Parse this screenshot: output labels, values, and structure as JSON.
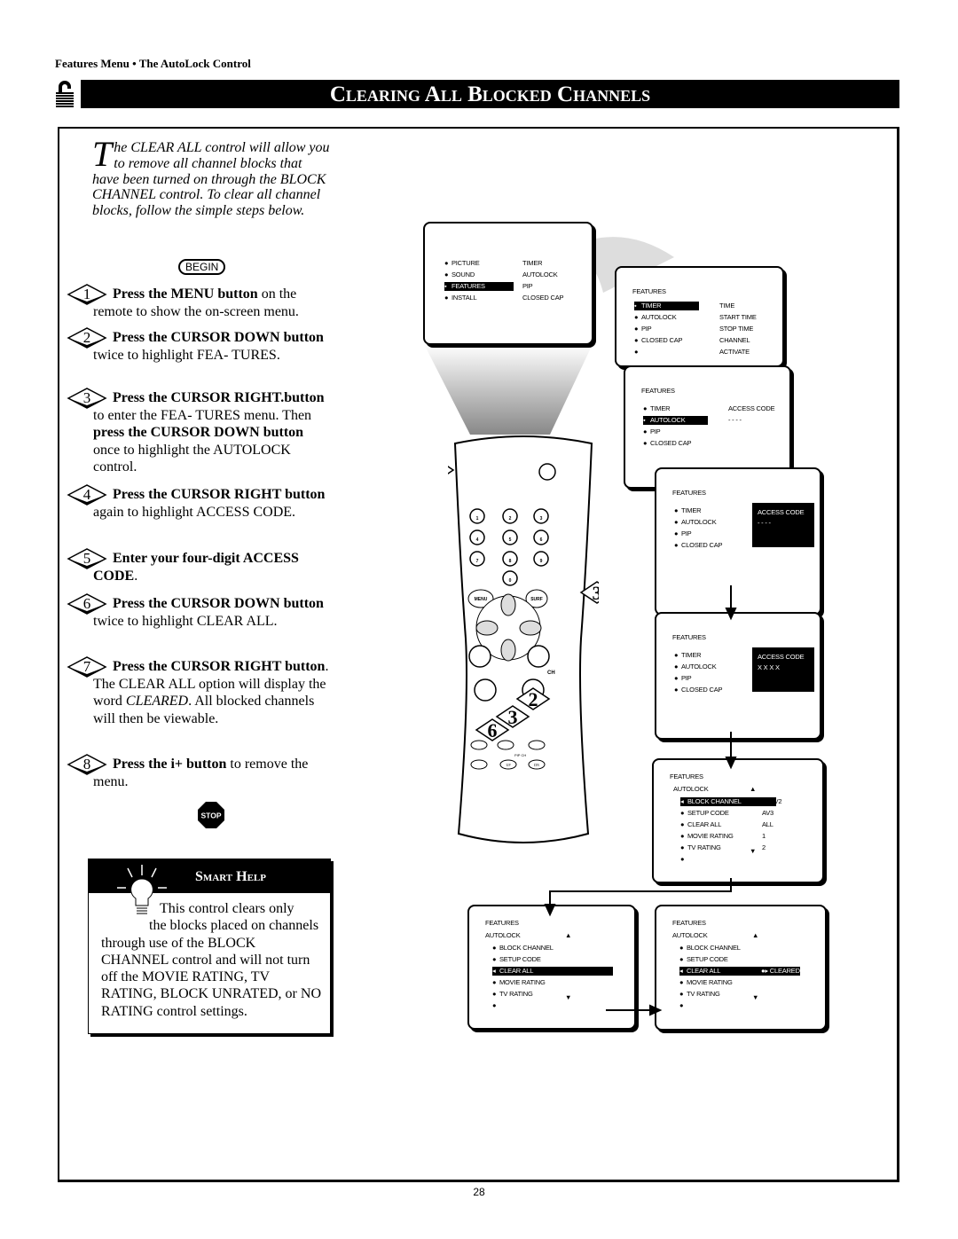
{
  "header": {
    "breadcrumb": "Features Menu • The AutoLock Control",
    "title": "Clearing All Blocked Channels"
  },
  "intro": {
    "drop_cap": "T",
    "text": "he CLEAR ALL control will allow you to remove all channel blocks that have been turned on through the BLOCK CHANNEL control. To clear all channel blocks, follow the simple steps below."
  },
  "begin_label": "BEGIN",
  "steps": [
    {
      "n": "1",
      "parts": [
        {
          "t": "Press the MENU button",
          "b": true
        },
        {
          "t": " on the remote to show the on-screen menu."
        }
      ]
    },
    {
      "n": "2",
      "parts": [
        {
          "t": "Press the CURSOR DOWN button",
          "b": true
        },
        {
          "t": " twice to highlight FEA- TURES."
        }
      ]
    },
    {
      "n": "3",
      "parts": [
        {
          "t": "Press the CURSOR RIGHT.button",
          "b": true
        },
        {
          "t": " to enter the FEA- TURES menu. Then "
        },
        {
          "t": "press the CURSOR DOWN button",
          "b": true
        },
        {
          "t": " once to highlight the AUTOLOCK control."
        }
      ]
    },
    {
      "n": "4",
      "parts": [
        {
          "t": "Press the CURSOR RIGHT button",
          "b": true
        },
        {
          "t": " again to highlight ACCESS CODE."
        }
      ]
    },
    {
      "n": "5",
      "parts": [
        {
          "t": "Enter your four-digit ACCESS CODE",
          "b": true
        },
        {
          "t": "."
        }
      ]
    },
    {
      "n": "6",
      "parts": [
        {
          "t": "Press the CURSOR DOWN button",
          "b": true
        },
        {
          "t": " twice to highlight CLEAR ALL."
        }
      ]
    },
    {
      "n": "7",
      "parts": [
        {
          "t": "Press the CURSOR RIGHT button",
          "b": true
        },
        {
          "t": ". The CLEAR ALL option will display the word "
        },
        {
          "t": "CLEARED",
          "i": true
        },
        {
          "t": ". All blocked channels will then be viewable."
        }
      ]
    },
    {
      "n": "8",
      "parts": [
        {
          "t": "Press the i+ button",
          "b": true
        },
        {
          "t": " to remove the menu."
        }
      ]
    }
  ],
  "stop_label": "STOP",
  "smart_help": {
    "title": "Smart Help",
    "first": "This control clears only",
    "indent2": "the blocks placed on channels",
    "rest": "through use of the BLOCK CHANNEL control and will not turn off the MOVIE RATING, TV RATING, BLOCK UNRATED, or NO RATING control settings."
  },
  "remote": {
    "numbers": [
      "1",
      "2",
      "3",
      "4",
      "5",
      "6",
      "7",
      "8",
      "9",
      "0"
    ],
    "menu": "MENU",
    "surf": "SURF",
    "sap": "SAP",
    "tv": "TV",
    "vcr": "VCR",
    "acc": "ACC",
    "smart": "SMART",
    "ch": "CH",
    "pipch": "PIP CH",
    "up": "UP",
    "dn": "DN",
    "ach": "A/CH",
    "callouts": [
      "8",
      "5",
      "1",
      "3",
      "4",
      "7",
      "2",
      "3",
      "6"
    ]
  },
  "menus": [
    {
      "id": "main",
      "rows": [
        [
          "PICTURE",
          "TIMER",
          0
        ],
        [
          "SOUND",
          "AUTOLOCK",
          0
        ],
        [
          "FEATURES",
          "PIP",
          1
        ],
        [
          "INSTALL",
          "CLOSED  CAP",
          0
        ]
      ]
    },
    {
      "id": "features-timer",
      "title": "FEATURES",
      "rows": [
        [
          "TIMER",
          "TIME",
          1
        ],
        [
          "AUTOLOCK",
          "START  TIME",
          0
        ],
        [
          "PIP",
          "STOP  TIME",
          0
        ],
        [
          "CLOSED  CAP",
          "CHANNEL",
          0
        ],
        [
          "",
          "ACTIVATE",
          0
        ]
      ]
    },
    {
      "id": "features-autolock",
      "title": "FEATURES",
      "rows": [
        [
          "TIMER",
          "ACCESS  CODE",
          0
        ],
        [
          "AUTOLOCK",
          "-  -  -  -",
          1
        ],
        [
          "PIP",
          "",
          0
        ],
        [
          "CLOSED  CAP",
          "",
          0
        ]
      ]
    },
    {
      "id": "access-code-empty",
      "title": "FEATURES",
      "rows": [
        [
          "TIMER",
          "",
          0
        ],
        [
          "AUTOLOCK",
          "",
          0
        ],
        [
          "PIP",
          "",
          0
        ],
        [
          "CLOSED  CAP",
          "",
          0
        ]
      ],
      "box": [
        "ACCESS  CODE",
        "-  -  -  -"
      ]
    },
    {
      "id": "access-code-entered",
      "title": "FEATURES",
      "rows": [
        [
          "TIMER",
          "",
          0
        ],
        [
          "AUTOLOCK",
          "",
          0
        ],
        [
          "PIP",
          "",
          0
        ],
        [
          "CLOSED  CAP",
          "",
          0
        ]
      ],
      "box": [
        "ACCESS  CODE",
        "X  X  X  X"
      ]
    },
    {
      "id": "autolock-block",
      "title": "FEATURES",
      "sub": "AUTOLOCK",
      "rows": [
        [
          "BLOCK  CHANNEL",
          "AV2",
          1
        ],
        [
          "SETUP  CODE",
          "AV3",
          0
        ],
        [
          "CLEAR  ALL",
          "ALL",
          0
        ],
        [
          "MOVIE  RATING",
          "1",
          0
        ],
        [
          "TV  RATING",
          "2",
          0
        ],
        [
          "",
          "",
          0
        ]
      ]
    },
    {
      "id": "autolock-clearall",
      "title": "FEATURES",
      "sub": "AUTOLOCK",
      "rows": [
        [
          "BLOCK  CHANNEL",
          "",
          0
        ],
        [
          "SETUP  CODE",
          "",
          0
        ],
        [
          "CLEAR  ALL",
          "",
          1
        ],
        [
          "MOVIE  RATING",
          "",
          0
        ],
        [
          "TV  RATING",
          "",
          0
        ],
        [
          "",
          "",
          0
        ]
      ]
    },
    {
      "id": "autolock-cleared",
      "title": "FEATURES",
      "sub": "AUTOLOCK",
      "rows": [
        [
          "BLOCK  CHANNEL",
          "",
          0
        ],
        [
          "SETUP  CODE",
          "",
          0
        ],
        [
          "CLEAR  ALL",
          "CLEARED",
          1
        ],
        [
          "MOVIE  RATING",
          "",
          0
        ],
        [
          "TV  RATING",
          "",
          0
        ],
        [
          "",
          "",
          0
        ]
      ]
    }
  ],
  "page_number": "28"
}
